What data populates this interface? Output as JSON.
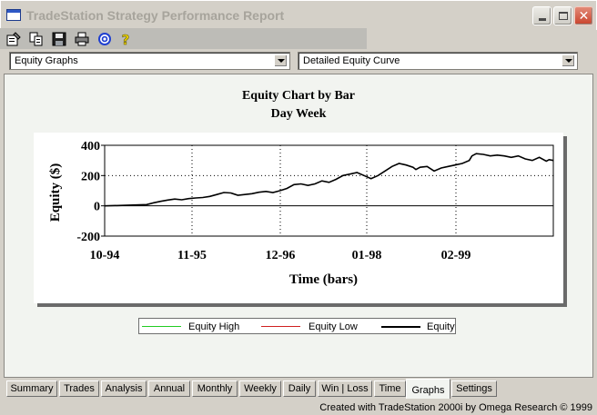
{
  "window": {
    "title": "TradeStation Strategy Performance Report"
  },
  "toolbar": {
    "tools": [
      {
        "name": "properties-icon"
      },
      {
        "name": "copy-icon"
      },
      {
        "name": "save-icon"
      },
      {
        "name": "print-icon"
      },
      {
        "name": "target-icon"
      },
      {
        "name": "help-icon"
      }
    ]
  },
  "selectors": {
    "report_type": "Equity Graphs",
    "graph_type": "Detailed Equity Curve"
  },
  "chart_data": {
    "type": "line",
    "title": "Equity Chart by Bar",
    "subtitle": "Day Week",
    "xlabel": "Time (bars)",
    "ylabel": "Equity ($)",
    "x_ticks": [
      "10-94",
      "11-95",
      "12-96",
      "01-98",
      "02-99"
    ],
    "y_ticks": [
      "400",
      "200",
      "0",
      "-200"
    ],
    "ylim": [
      -200,
      400
    ],
    "grid": true,
    "legend_position": "bottom",
    "legend": [
      "Equity High",
      "Equity Low",
      "Equity"
    ],
    "series": [
      {
        "name": "Equity",
        "color": "#000000",
        "x": [
          0,
          1,
          2,
          3,
          3.5,
          4,
          4.5,
          5,
          5.5,
          6,
          6.5,
          7,
          7.5,
          8,
          8.5,
          9,
          9.5,
          10,
          10.5,
          11,
          11.5,
          12,
          12.5,
          13,
          13.5,
          14,
          14.5,
          15,
          15.5,
          16,
          16.5,
          17,
          17.5,
          18,
          18.5,
          19,
          19.5,
          20,
          20.5,
          21,
          21.5,
          22,
          22.2,
          22.5,
          23,
          23.5,
          24,
          24.5,
          25,
          25.5,
          26,
          26.2,
          26.5,
          27,
          27.5,
          28,
          28.5,
          29,
          29.5,
          30,
          30.5,
          31,
          31.5,
          31.7,
          32
        ],
        "y": [
          0,
          2,
          5,
          8,
          20,
          30,
          38,
          45,
          40,
          48,
          52,
          55,
          62,
          75,
          88,
          85,
          70,
          75,
          80,
          90,
          95,
          88,
          100,
          115,
          140,
          145,
          135,
          145,
          165,
          155,
          175,
          200,
          210,
          220,
          200,
          180,
          200,
          230,
          260,
          280,
          270,
          255,
          240,
          255,
          260,
          230,
          250,
          260,
          270,
          280,
          300,
          330,
          345,
          340,
          330,
          335,
          330,
          320,
          330,
          310,
          300,
          320,
          295,
          305,
          300
        ]
      }
    ]
  },
  "tabs": [
    "Summary",
    "Trades",
    "Analysis",
    "Annual",
    "Monthly",
    "Weekly",
    "Daily",
    "Win | Loss",
    "Time",
    "Graphs",
    "Settings"
  ],
  "active_tab": "Graphs",
  "status": {
    "credit": "Created with TradeStation 2000i by Omega Research © 1999"
  }
}
